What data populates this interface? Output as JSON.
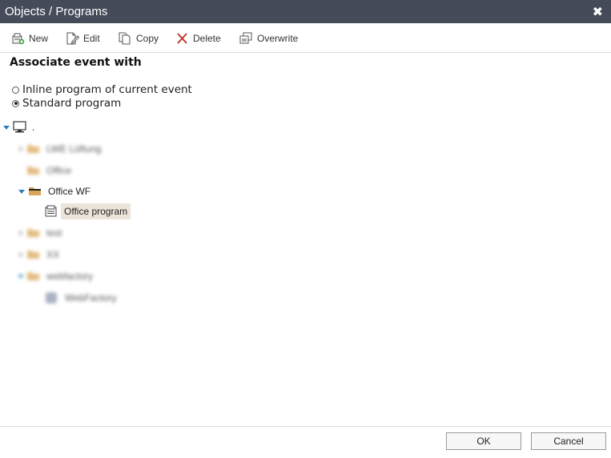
{
  "window": {
    "title": "Objects / Programs",
    "close_glyph": "✖"
  },
  "toolbar": {
    "new_label": "New",
    "edit_label": "Edit",
    "copy_label": "Copy",
    "delete_label": "Delete",
    "overwrite_label": "Overwrite"
  },
  "section": {
    "heading": "Associate event with"
  },
  "options": [
    {
      "label": "Inline program of current event",
      "checked": false
    },
    {
      "label": "Standard program",
      "checked": true
    }
  ],
  "tree": {
    "root_label": ".",
    "items": [
      {
        "label": "LWE Lüftung",
        "type": "folder",
        "expanded": false,
        "blurred": true
      },
      {
        "label": "Office",
        "type": "folder",
        "expanded": false,
        "blurred": true
      },
      {
        "label": "Office WF",
        "type": "folder",
        "expanded": true,
        "blurred": false
      },
      {
        "label": "Office program",
        "type": "program",
        "selected": true,
        "blurred": false
      },
      {
        "label": "test",
        "type": "folder",
        "expanded": false,
        "blurred": true
      },
      {
        "label": "XX",
        "type": "folder",
        "expanded": false,
        "blurred": true
      },
      {
        "label": "webfactory",
        "type": "folder",
        "expanded": true,
        "blurred": true
      },
      {
        "label": "WebFactory",
        "type": "program",
        "selected": false,
        "blurred": true
      }
    ]
  },
  "footer": {
    "ok_label": "OK",
    "cancel_label": "Cancel"
  },
  "colors": {
    "titlebar": "#454b59",
    "selection": "#ede4d9",
    "folder": "#d9a656",
    "expander": "#2a7fb8",
    "delete_red": "#c0392b"
  }
}
